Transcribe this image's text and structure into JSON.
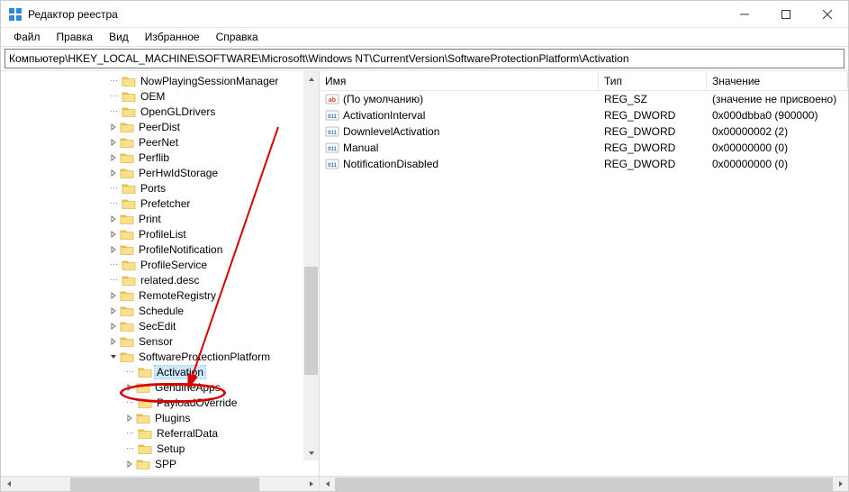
{
  "window": {
    "title": "Редактор реестра"
  },
  "menu": {
    "file": "Файл",
    "edit": "Правка",
    "view": "Вид",
    "favorites": "Избранное",
    "help": "Справка"
  },
  "address": "Компьютер\\HKEY_LOCAL_MACHINE\\SOFTWARE\\Microsoft\\Windows NT\\CurrentVersion\\SoftwareProtectionPlatform\\Activation",
  "tree": {
    "nodes": [
      {
        "label": "NowPlayingSessionManager",
        "expand": null,
        "depth": 0
      },
      {
        "label": "OEM",
        "expand": null,
        "depth": 0
      },
      {
        "label": "OpenGLDrivers",
        "expand": null,
        "depth": 0
      },
      {
        "label": "PeerDist",
        "expand": "closed",
        "depth": 0
      },
      {
        "label": "PeerNet",
        "expand": "closed",
        "depth": 0
      },
      {
        "label": "Perflib",
        "expand": "closed",
        "depth": 0
      },
      {
        "label": "PerHwIdStorage",
        "expand": "closed",
        "depth": 0
      },
      {
        "label": "Ports",
        "expand": null,
        "depth": 0
      },
      {
        "label": "Prefetcher",
        "expand": null,
        "depth": 0
      },
      {
        "label": "Print",
        "expand": "closed",
        "depth": 0
      },
      {
        "label": "ProfileList",
        "expand": "closed",
        "depth": 0
      },
      {
        "label": "ProfileNotification",
        "expand": "closed",
        "depth": 0
      },
      {
        "label": "ProfileService",
        "expand": null,
        "depth": 0
      },
      {
        "label": "related.desc",
        "expand": null,
        "depth": 0
      },
      {
        "label": "RemoteRegistry",
        "expand": "closed",
        "depth": 0
      },
      {
        "label": "Schedule",
        "expand": "closed",
        "depth": 0
      },
      {
        "label": "SecEdit",
        "expand": "closed",
        "depth": 0
      },
      {
        "label": "Sensor",
        "expand": "closed",
        "depth": 0
      },
      {
        "label": "SoftwareProtectionPlatform",
        "expand": "open",
        "depth": 0
      },
      {
        "label": "Activation",
        "expand": null,
        "depth": 1,
        "selected": true
      },
      {
        "label": "GenuineApps",
        "expand": "closed",
        "depth": 1
      },
      {
        "label": "PayloadOverride",
        "expand": null,
        "depth": 1
      },
      {
        "label": "Plugins",
        "expand": "closed",
        "depth": 1
      },
      {
        "label": "ReferralData",
        "expand": null,
        "depth": 1
      },
      {
        "label": "Setup",
        "expand": null,
        "depth": 1
      },
      {
        "label": "SPP",
        "expand": "closed",
        "depth": 1
      }
    ]
  },
  "columns": {
    "name": "Имя",
    "type": "Тип",
    "value": "Значение"
  },
  "values": [
    {
      "icon": "string",
      "name": "(По умолчанию)",
      "type": "REG_SZ",
      "value": "(значение не присвоено)"
    },
    {
      "icon": "binary",
      "name": "ActivationInterval",
      "type": "REG_DWORD",
      "value": "0x000dbba0 (900000)"
    },
    {
      "icon": "binary",
      "name": "DownlevelActivation",
      "type": "REG_DWORD",
      "value": "0x00000002 (2)"
    },
    {
      "icon": "binary",
      "name": "Manual",
      "type": "REG_DWORD",
      "value": "0x00000000 (0)"
    },
    {
      "icon": "binary",
      "name": "NotificationDisabled",
      "type": "REG_DWORD",
      "value": "0x00000000 (0)"
    }
  ]
}
